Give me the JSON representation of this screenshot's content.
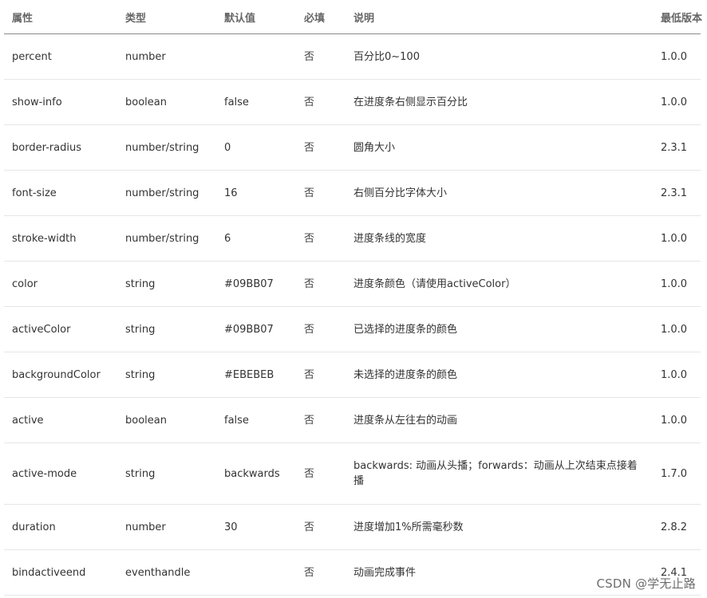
{
  "table": {
    "headers": [
      "属性",
      "类型",
      "默认值",
      "必填",
      "说明",
      "最低版本"
    ],
    "rows": [
      {
        "attr": "percent",
        "type": "number",
        "default": "",
        "required": "否",
        "desc": "百分比0~100",
        "version": "1.0.0"
      },
      {
        "attr": "show-info",
        "type": "boolean",
        "default": "false",
        "required": "否",
        "desc": "在进度条右侧显示百分比",
        "version": "1.0.0"
      },
      {
        "attr": "border-radius",
        "type": "number/string",
        "default": "0",
        "required": "否",
        "desc": "圆角大小",
        "version": "2.3.1"
      },
      {
        "attr": "font-size",
        "type": "number/string",
        "default": "16",
        "required": "否",
        "desc": "右侧百分比字体大小",
        "version": "2.3.1"
      },
      {
        "attr": "stroke-width",
        "type": "number/string",
        "default": "6",
        "required": "否",
        "desc": "进度条线的宽度",
        "version": "1.0.0"
      },
      {
        "attr": "color",
        "type": "string",
        "default": "#09BB07",
        "required": "否",
        "desc": "进度条颜色（请使用activeColor）",
        "version": "1.0.0"
      },
      {
        "attr": "activeColor",
        "type": "string",
        "default": "#09BB07",
        "required": "否",
        "desc": "已选择的进度条的颜色",
        "version": "1.0.0"
      },
      {
        "attr": "backgroundColor",
        "type": "string",
        "default": "#EBEBEB",
        "required": "否",
        "desc": "未选择的进度条的颜色",
        "version": "1.0.0"
      },
      {
        "attr": "active",
        "type": "boolean",
        "default": "false",
        "required": "否",
        "desc": "进度条从左往右的动画",
        "version": "1.0.0"
      },
      {
        "attr": "active-mode",
        "type": "string",
        "default": "backwards",
        "required": "否",
        "desc": "backwards: 动画从头播；forwards：动画从上次结束点接着播",
        "version": "1.7.0"
      },
      {
        "attr": "duration",
        "type": "number",
        "default": "30",
        "required": "否",
        "desc": "进度增加1%所需毫秒数",
        "version": "2.8.2"
      },
      {
        "attr": "bindactiveend",
        "type": "eventhandle",
        "default": "",
        "required": "否",
        "desc": "动画完成事件",
        "version": "2.4.1"
      }
    ]
  },
  "watermark": "CSDN @学无止路"
}
